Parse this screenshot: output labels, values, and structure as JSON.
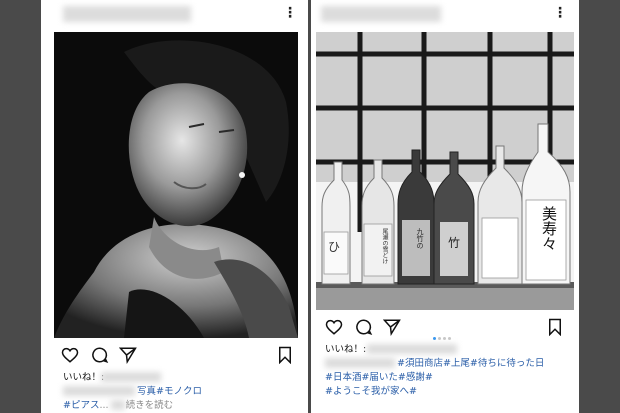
{
  "left_post": {
    "more_icon": "⋮",
    "likes_label": "いいね！:",
    "caption_line1_tag": "写真#モノクロ",
    "caption_line2_tag": "#ピアス",
    "caption_line2_ellipsis": "...",
    "read_more": "続きを読む"
  },
  "right_post": {
    "more_icon": "⋮",
    "likes_label": "いいね！:",
    "caption_line1": "#須田商店#上尾#待ちに待った日",
    "caption_line2": "#日本酒#届いた#感謝#",
    "caption_line3": "#ようこそ我が家へ#",
    "bottle_labels": [
      "ひ",
      "尾瀬の雪どけ",
      "九竹の",
      "竹",
      "美寿々"
    ],
    "carousel": {
      "count": 4,
      "active_index": 0
    }
  },
  "colors": {
    "tag": "#2a5ea8",
    "carousel_active": "#3897f0",
    "background": "#4a4a4a"
  }
}
